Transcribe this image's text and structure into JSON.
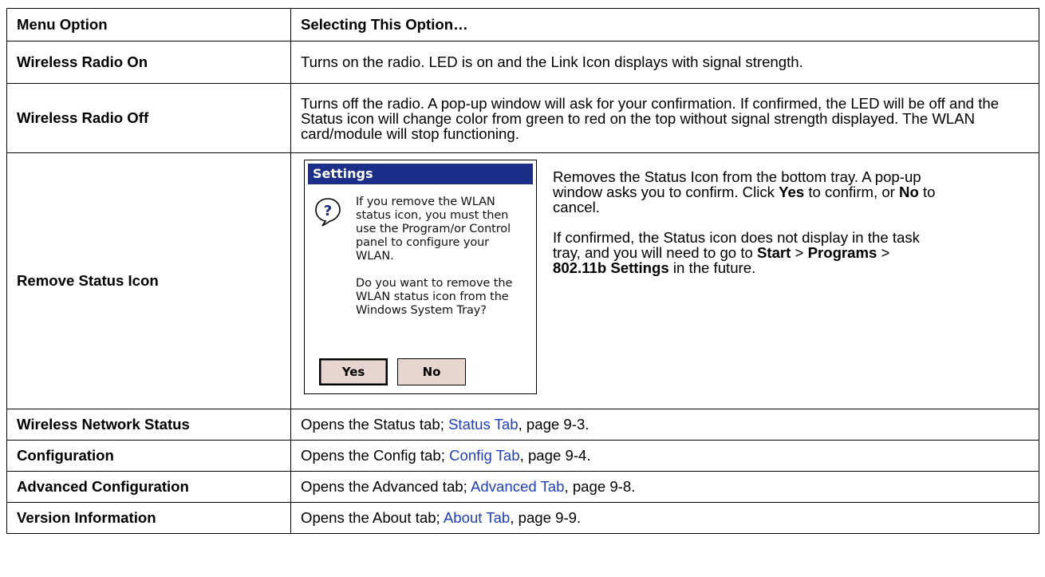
{
  "header": {
    "col1": "Menu Option",
    "col2": "Selecting This Option…"
  },
  "rows": [
    {
      "option": "Wireless Radio On",
      "desc": "Turns on the radio. LED is on and the Link Icon displays with signal strength."
    },
    {
      "option": "Wireless Radio Off",
      "desc": "Turns off the radio. A pop-up window will ask for your confirmation. If confirmed, the LED will be off and the Status icon will change color from green to red on the top without signal strength displayed. The WLAN card/module will stop functioning."
    },
    {
      "option": "Remove Status Icon",
      "p1_a": "Removes the Status Icon from the bottom tray. A pop-up window asks you to confirm. Click ",
      "p1_yes": "Yes",
      "p1_b": " to confirm, or ",
      "p1_no": "No",
      "p1_c": " to cancel.",
      "p2_a": "If confirmed, the Status icon does not display in the task tray, and you will need to go to ",
      "p2_start": "Start",
      "p2_sep1": " > ",
      "p2_programs": "Programs",
      "p2_sep2": " > ",
      "p2_settings": "802.11b Settings",
      "p2_c": " in the future.",
      "dialog": {
        "title": "Settings",
        "icon": "question-balloon-icon",
        "text1": "If you remove the WLAN status icon, you must then use the Program/or Control panel to configure your WLAN.",
        "text2": "Do you want to remove the WLAN status icon from the Windows System Tray?",
        "yes": "Yes",
        "no": "No"
      }
    },
    {
      "option": "Wireless Network Status",
      "desc_a": "Opens the Status tab; ",
      "link": "Status Tab",
      "desc_b": ", page 9-3."
    },
    {
      "option": "Configuration",
      "desc_a": "Opens the Config tab; ",
      "link": "Config Tab",
      "desc_b": ", page 9-4."
    },
    {
      "option": "Advanced Configuration",
      "desc_a": "Opens the Advanced tab; ",
      "link": "Advanced Tab",
      "desc_b": ", page 9-8."
    },
    {
      "option": "Version Information",
      "desc_a": "Opens the About tab; ",
      "link": "About Tab",
      "desc_b": ", page 9-9."
    }
  ],
  "colors": {
    "link": "#1f3fbf",
    "dialog_title_bg": "#1b2e88",
    "button_bg": "#e7d6cf"
  }
}
